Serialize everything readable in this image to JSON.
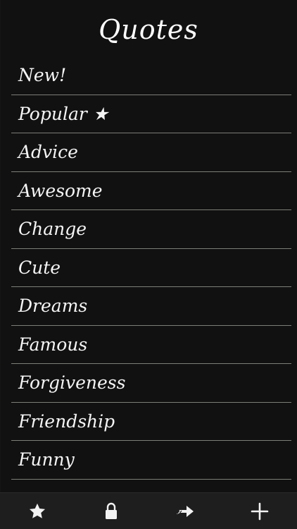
{
  "header": {
    "title": "Quotes"
  },
  "categories": [
    {
      "label": "New!"
    },
    {
      "label": "Popular ★"
    },
    {
      "label": "Advice"
    },
    {
      "label": "Awesome"
    },
    {
      "label": "Change"
    },
    {
      "label": "Cute"
    },
    {
      "label": "Dreams"
    },
    {
      "label": "Famous"
    },
    {
      "label": "Forgiveness"
    },
    {
      "label": "Friendship"
    },
    {
      "label": "Funny"
    }
  ],
  "toolbar": {
    "buttons": [
      {
        "icon": "star-icon"
      },
      {
        "icon": "lock-icon"
      },
      {
        "icon": "share-arrow-icon"
      },
      {
        "icon": "plus-icon"
      }
    ]
  },
  "colors": {
    "background": "#111111",
    "text": "#f5f5f5",
    "divider": "#7c7f78",
    "toolbar": "#1e1e1e"
  }
}
